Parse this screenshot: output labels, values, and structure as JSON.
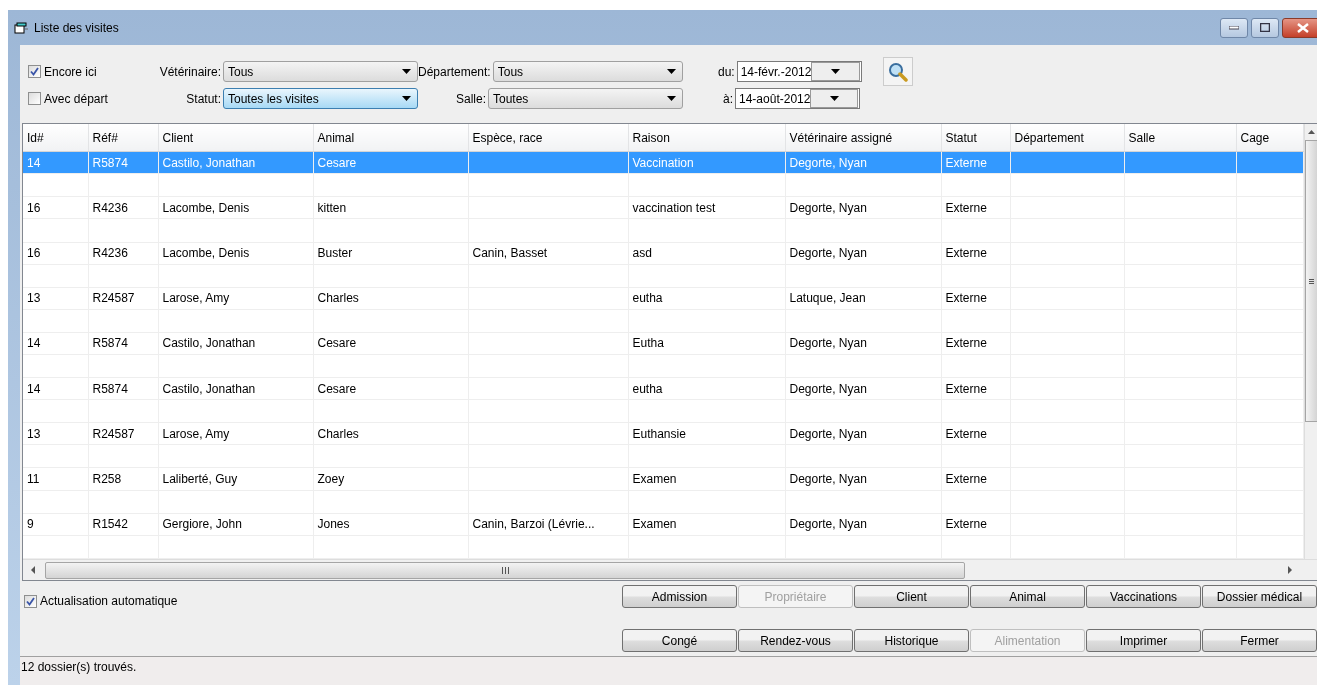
{
  "window": {
    "title": "Liste des visites"
  },
  "filters": {
    "checkboxes": [
      {
        "label": "Encore ici",
        "checked": true
      },
      {
        "label": "Avec départ",
        "checked": false
      }
    ],
    "combos": [
      {
        "label": "Vétérinaire:",
        "value": "Tous",
        "focused": false
      },
      {
        "label": "Département:",
        "value": "Tous",
        "focused": false
      },
      {
        "label": "Statut:",
        "value": "Toutes les visites",
        "focused": true
      },
      {
        "label": "Salle:",
        "value": "Toutes",
        "focused": false
      }
    ],
    "dates": [
      {
        "label": "du:",
        "value": "14-févr.-2012"
      },
      {
        "label": "à:",
        "value": "14-août-2012"
      }
    ]
  },
  "table": {
    "columns": [
      "Id#",
      "Réf#",
      "Client",
      "Animal",
      "Espèce, race",
      "Raison",
      "Vétérinaire assigné",
      "Statut",
      "Département",
      "Salle",
      "Cage"
    ],
    "rows": [
      {
        "selected": true,
        "cells": [
          "14",
          "R5874",
          "Castilo, Jonathan",
          "Cesare",
          "",
          "Vaccination",
          "Degorte, Nyan",
          "Externe",
          "",
          "",
          ""
        ]
      },
      {
        "selected": false,
        "cells": [
          "16",
          "R4236",
          "Lacombe, Denis",
          "kitten",
          "",
          "vaccination test",
          "Degorte, Nyan",
          "Externe",
          "",
          "",
          ""
        ]
      },
      {
        "selected": false,
        "cells": [
          "16",
          "R4236",
          "Lacombe, Denis",
          "Buster",
          "Canin, Basset",
          "asd",
          "Degorte, Nyan",
          "Externe",
          "",
          "",
          ""
        ]
      },
      {
        "selected": false,
        "cells": [
          "13",
          "R24587",
          "Larose, Amy",
          "Charles",
          "",
          "eutha",
          "Latuque, Jean",
          "Externe",
          "",
          "",
          ""
        ]
      },
      {
        "selected": false,
        "cells": [
          "14",
          "R5874",
          "Castilo, Jonathan",
          "Cesare",
          "",
          "Eutha",
          "Degorte, Nyan",
          "Externe",
          "",
          "",
          ""
        ]
      },
      {
        "selected": false,
        "cells": [
          "14",
          "R5874",
          "Castilo, Jonathan",
          "Cesare",
          "",
          "eutha",
          "Degorte, Nyan",
          "Externe",
          "",
          "",
          ""
        ]
      },
      {
        "selected": false,
        "cells": [
          "13",
          "R24587",
          "Larose, Amy",
          "Charles",
          "",
          "Euthansie",
          "Degorte, Nyan",
          "Externe",
          "",
          "",
          ""
        ]
      },
      {
        "selected": false,
        "cells": [
          "11",
          "R258",
          "Laliberté, Guy",
          "Zoey",
          "",
          "Examen",
          "Degorte, Nyan",
          "Externe",
          "",
          "",
          ""
        ]
      },
      {
        "selected": false,
        "cells": [
          "9",
          "R1542",
          "Gergiore, John",
          "Jones",
          "Canin, Barzoi (Lévrie...",
          "Examen",
          "Degorte, Nyan",
          "Externe",
          "",
          "",
          ""
        ]
      }
    ]
  },
  "auto_refresh": {
    "label": "Actualisation automatique",
    "checked": true
  },
  "buttons": [
    [
      {
        "label": "Admission",
        "disabled": false
      },
      {
        "label": "Propriétaire",
        "disabled": true
      },
      {
        "label": "Client",
        "disabled": false
      },
      {
        "label": "Animal",
        "disabled": false
      },
      {
        "label": "Vaccinations",
        "disabled": false
      },
      {
        "label": "Dossier médical",
        "disabled": false
      }
    ],
    [
      {
        "label": "Congé",
        "disabled": false
      },
      {
        "label": "Rendez-vous",
        "disabled": false
      },
      {
        "label": "Historique",
        "disabled": false
      },
      {
        "label": "Alimentation",
        "disabled": true
      },
      {
        "label": "Imprimer",
        "disabled": false
      },
      {
        "label": "Fermer",
        "disabled": false
      }
    ]
  ],
  "status_bar": "12 dossier(s) trouvés."
}
